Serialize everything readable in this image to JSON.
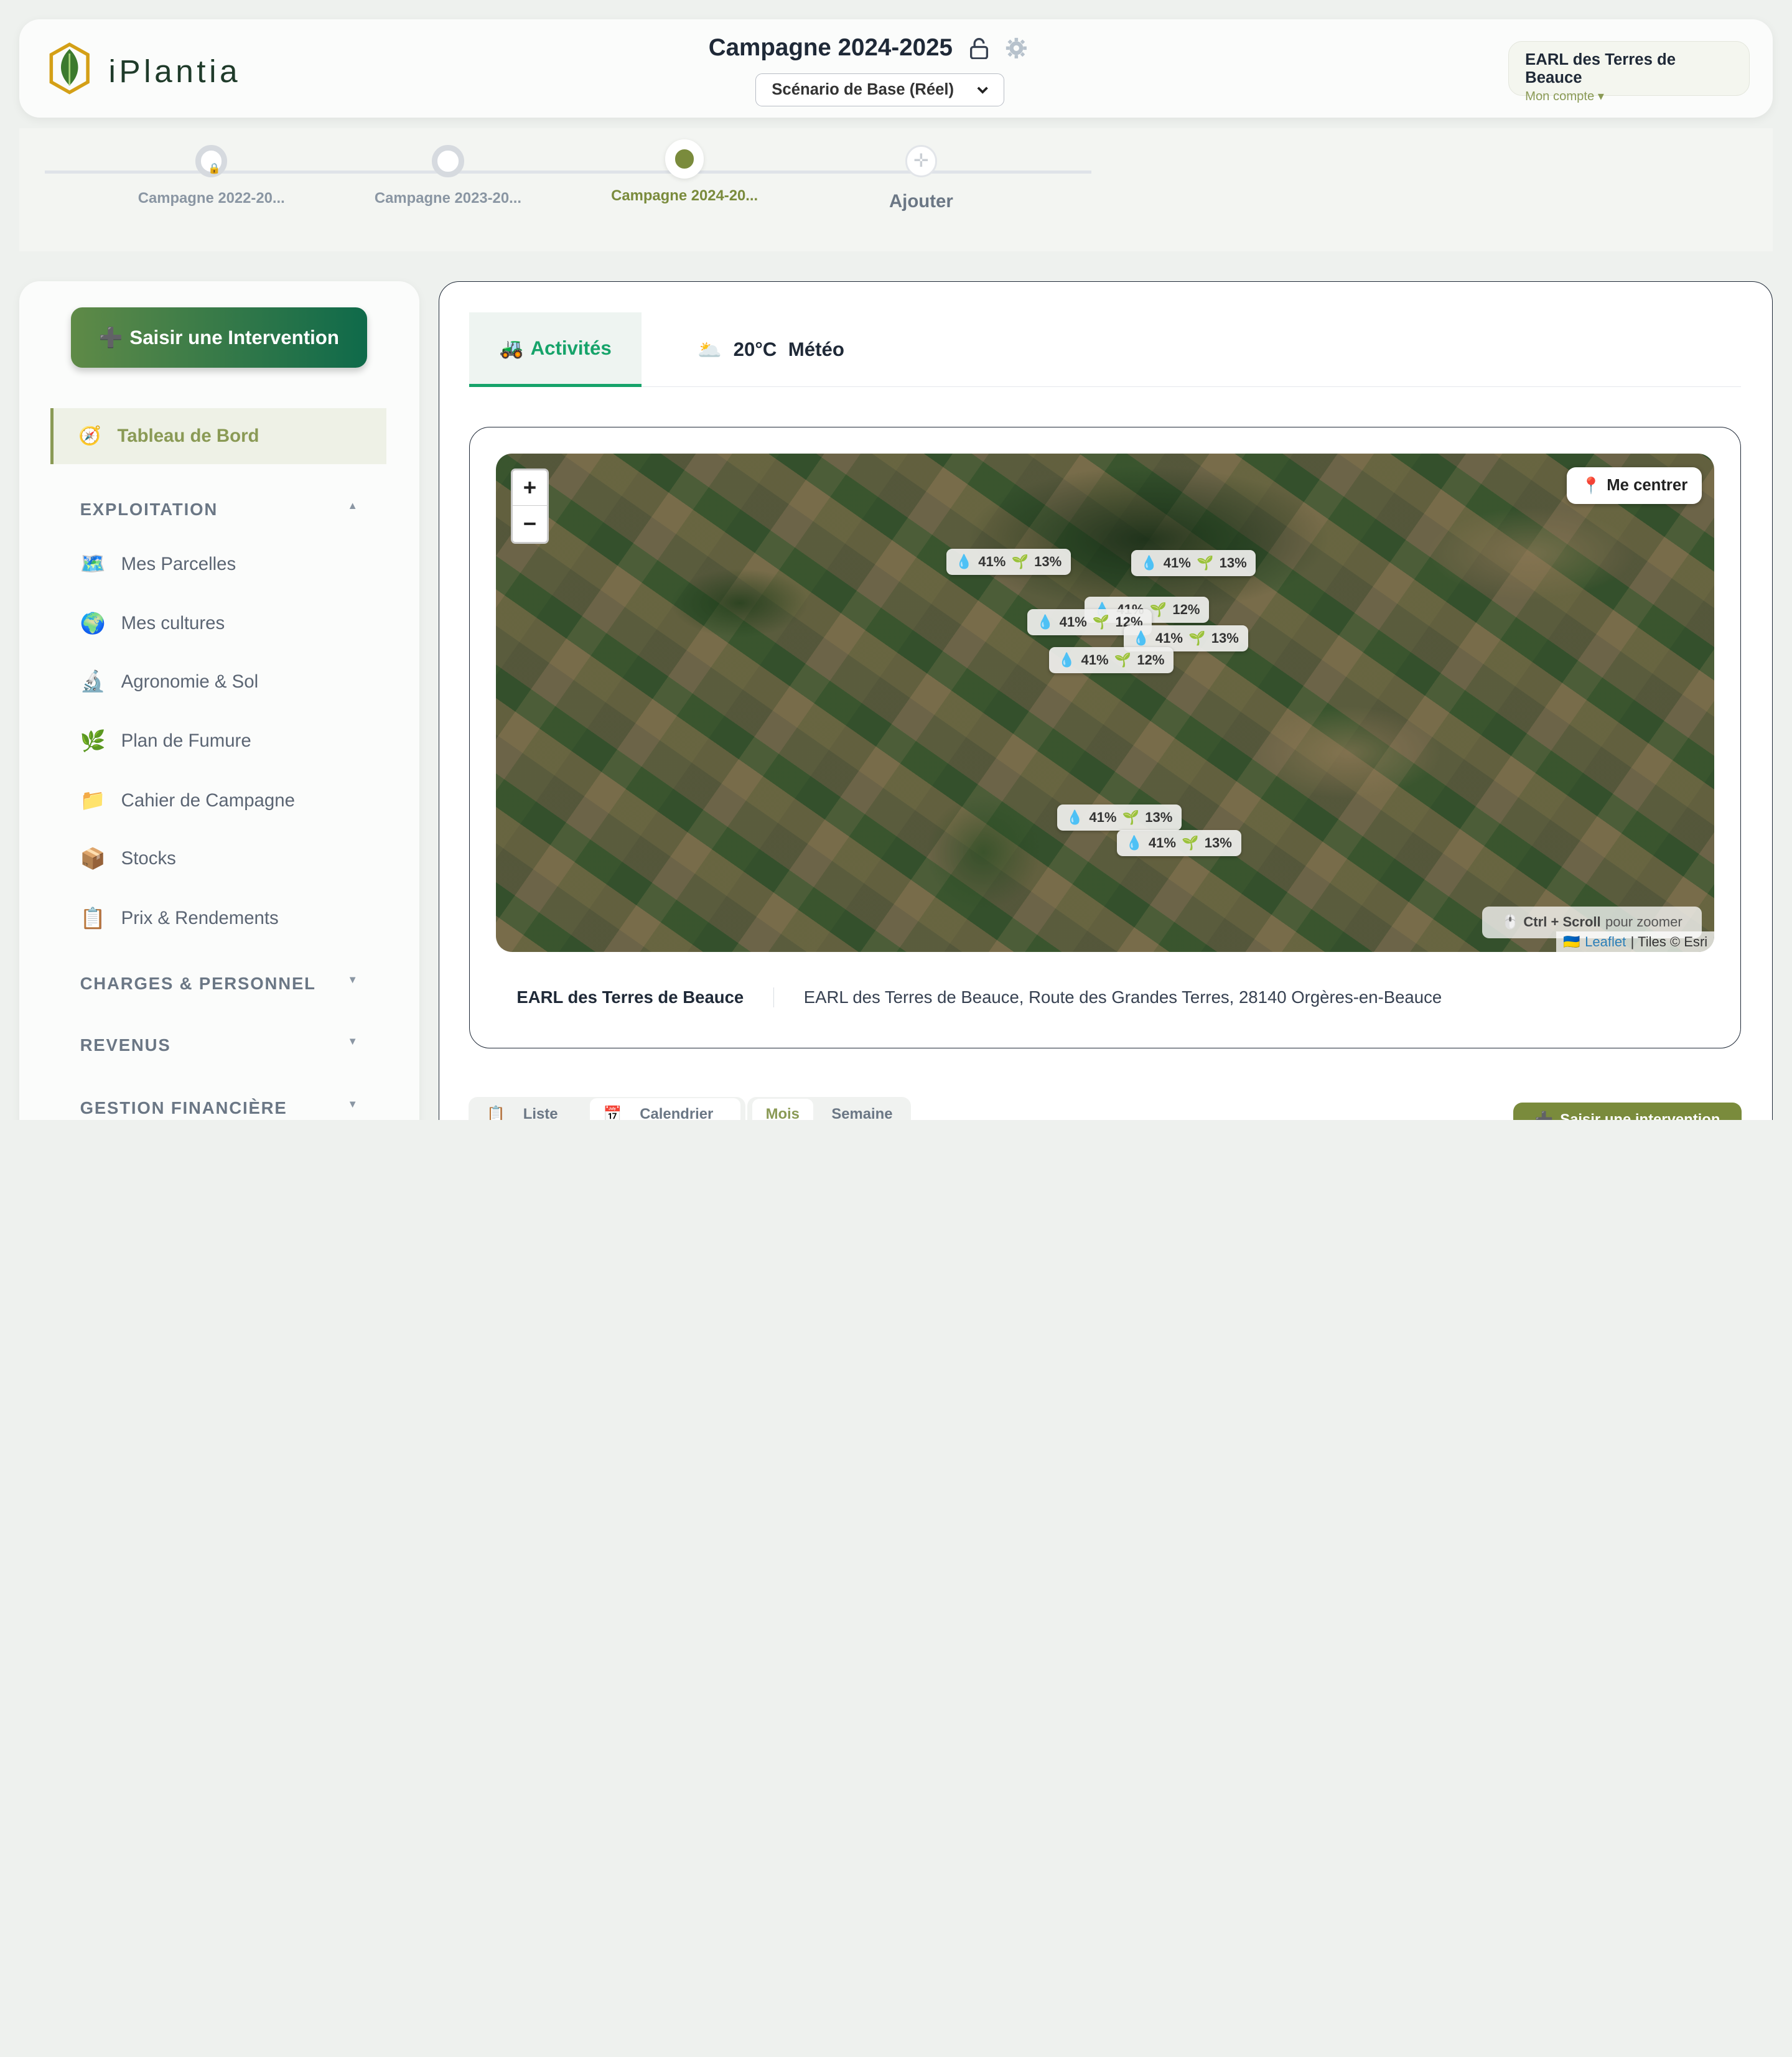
{
  "header": {
    "logo_text": "iPlantia",
    "campaign_title": "Campagne 2024-2025",
    "scenario_selected": "Scénario de Base (Réel)",
    "account_name": "EARL des Terres de Beauce",
    "account_sub": "Mon compte ▾"
  },
  "timeline": {
    "steps": [
      {
        "label": "Campagne 2022-20..."
      },
      {
        "label": "Campagne 2023-20..."
      },
      {
        "label": "Campagne 2024-20..."
      },
      {
        "label": "Ajouter"
      }
    ]
  },
  "sidebar": {
    "cta_label": "Saisir une Intervention",
    "dashboard_label": "Tableau de Bord",
    "sections": [
      {
        "label": "EXPLOITATION",
        "chevron": "▲"
      },
      {
        "label": "CHARGES & PERSONNEL",
        "chevron": "▼"
      },
      {
        "label": "REVENUS",
        "chevron": "▼"
      },
      {
        "label": "GESTION FINANCIÈRE",
        "chevron": "▼"
      }
    ],
    "items": [
      {
        "label": "Mes Parcelles",
        "icon": "🗺️"
      },
      {
        "label": "Mes cultures",
        "icon": "🌍"
      },
      {
        "label": "Agronomie & Sol",
        "icon": "🔬"
      },
      {
        "label": "Plan de Fumure",
        "icon": "🌿"
      },
      {
        "label": "Cahier de Campagne",
        "icon": "📁"
      },
      {
        "label": "Stocks",
        "icon": "📦"
      },
      {
        "label": "Prix & Rendements",
        "icon": "📋"
      }
    ]
  },
  "main": {
    "tab_activities": "Activités",
    "tab_weather_temp": "20°C",
    "tab_weather_label": "Météo"
  },
  "map": {
    "zoom_in": "+",
    "zoom_out": "−",
    "center_label": "Me centrer",
    "zoom_hint_bold": "Ctrl + Scroll",
    "zoom_hint_rest": "pour zoomer",
    "attribution_leaflet": "Leaflet",
    "attribution_tiles": "| Tiles © Esri",
    "badges": [
      {
        "water": "41%",
        "growth": "13%"
      },
      {
        "water": "41%",
        "growth": "13%"
      },
      {
        "water": "41%",
        "growth": "12%"
      },
      {
        "water": "41%",
        "growth": "12%"
      },
      {
        "water": "41%",
        "growth": "13%"
      },
      {
        "water": "41%",
        "growth": "12%"
      },
      {
        "water": "41%",
        "growth": "13%"
      },
      {
        "water": "41%",
        "growth": "13%"
      }
    ]
  },
  "farm": {
    "name": "EARL des Terres de Beauce",
    "address": "EARL des Terres de Beauce, Route des Grandes Terres, 28140 Orgères-en-Beauce"
  },
  "bottom": {
    "view_list": "Liste",
    "view_calendar": "Calendrier",
    "period_month": "Mois",
    "period_week": "Semaine",
    "cta": "Saisir une intervention"
  }
}
